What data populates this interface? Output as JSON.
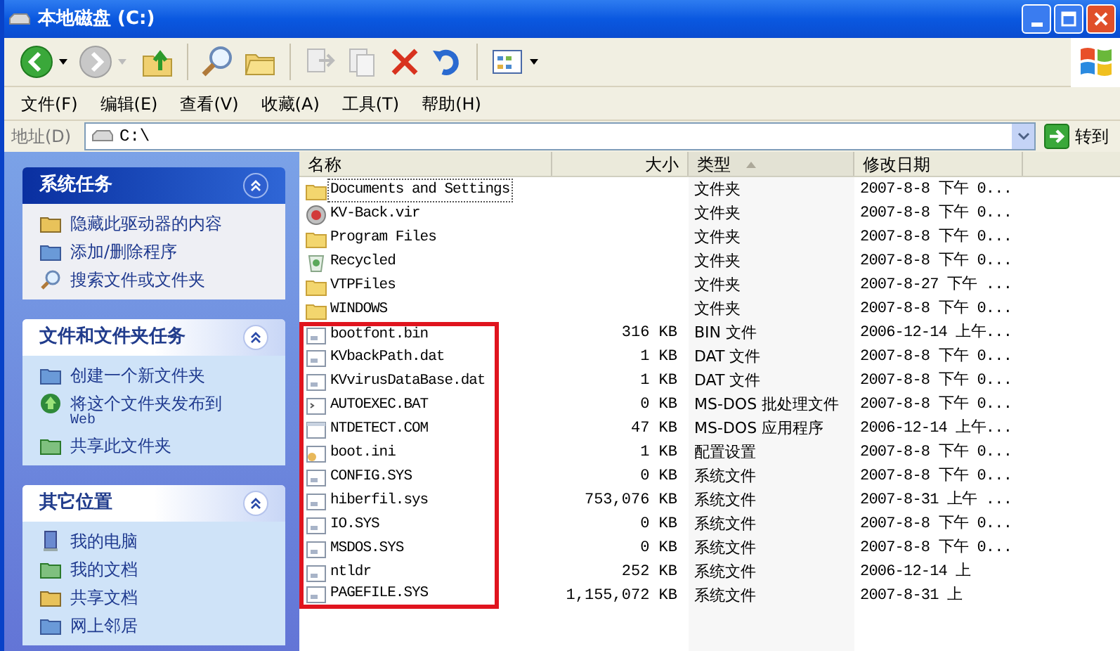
{
  "window": {
    "title": "本地磁盘 (C:)"
  },
  "menu": [
    "文件(F)",
    "编辑(E)",
    "查看(V)",
    "收藏(A)",
    "工具(T)",
    "帮助(H)"
  ],
  "address": {
    "label": "地址(D)",
    "value": "C:\\",
    "go": "转到"
  },
  "task_panels": [
    {
      "title": "系统任务",
      "emphasized": true,
      "items": [
        "隐藏此驱动器的内容",
        "添加/删除程序",
        "搜索文件或文件夹"
      ]
    },
    {
      "title": "文件和文件夹任务",
      "emphasized": false,
      "items": [
        "创建一个新文件夹",
        "将这个文件夹发布到",
        "共享此文件夹"
      ],
      "web_note": "Web"
    },
    {
      "title": "其它位置",
      "emphasized": false,
      "items": [
        "我的电脑",
        "我的文档",
        "共享文档",
        "网上邻居"
      ]
    }
  ],
  "columns": [
    {
      "label": "名称",
      "sorted": false
    },
    {
      "label": "大小",
      "sorted": false
    },
    {
      "label": "类型",
      "sorted": true
    },
    {
      "label": "修改日期",
      "sorted": false
    }
  ],
  "rows": [
    {
      "kind": "folder",
      "name": "Documents and Settings",
      "size": "",
      "type": "文件夹",
      "date": "2007-8-8 下午 0...",
      "focused": true,
      "marked": false
    },
    {
      "kind": "shield",
      "name": "KV-Back.vir",
      "size": "",
      "type": "文件夹",
      "date": "2007-8-8 下午 0...",
      "focused": false,
      "marked": false
    },
    {
      "kind": "folder",
      "name": "Program Files",
      "size": "",
      "type": "文件夹",
      "date": "2007-8-8 下午 0...",
      "focused": false,
      "marked": false
    },
    {
      "kind": "recycle",
      "name": "Recycled",
      "size": "",
      "type": "文件夹",
      "date": "2007-8-8 下午 0...",
      "focused": false,
      "marked": false
    },
    {
      "kind": "folder",
      "name": "VTPFiles",
      "size": "",
      "type": "文件夹",
      "date": "2007-8-27 下午 ...",
      "focused": false,
      "marked": false
    },
    {
      "kind": "folder",
      "name": "WINDOWS",
      "size": "",
      "type": "文件夹",
      "date": "2007-8-8 下午 0...",
      "focused": false,
      "marked": false
    },
    {
      "kind": "file",
      "name": "bootfont.bin",
      "size": "316 KB",
      "type": "BIN 文件",
      "date": "2006-12-14 上午...",
      "focused": false,
      "marked": true
    },
    {
      "kind": "file",
      "name": "KVbackPath.dat",
      "size": "1 KB",
      "type": "DAT 文件",
      "date": "2007-8-8 下午 0...",
      "focused": false,
      "marked": true
    },
    {
      "kind": "file",
      "name": "KVvirusDataBase.dat",
      "size": "1 KB",
      "type": "DAT 文件",
      "date": "2007-8-8 下午 0...",
      "focused": false,
      "marked": true
    },
    {
      "kind": "batch",
      "name": "AUTOEXEC.BAT",
      "size": "0 KB",
      "type": "MS-DOS 批处理文件",
      "date": "2007-8-8 下午 0...",
      "focused": false,
      "marked": true
    },
    {
      "kind": "program",
      "name": "NTDETECT.COM",
      "size": "47 KB",
      "type": "MS-DOS 应用程序",
      "date": "2006-12-14 上午...",
      "focused": false,
      "marked": true
    },
    {
      "kind": "settings",
      "name": "boot.ini",
      "size": "1 KB",
      "type": "配置设置",
      "date": "2007-8-8 下午 0...",
      "focused": false,
      "marked": true
    },
    {
      "kind": "file",
      "name": "CONFIG.SYS",
      "size": "0 KB",
      "type": "系统文件",
      "date": "2007-8-8 下午 0...",
      "focused": false,
      "marked": true
    },
    {
      "kind": "file",
      "name": "hiberfil.sys",
      "size": "753,076 KB",
      "type": "系统文件",
      "date": "2007-8-31 上午 ...",
      "focused": false,
      "marked": true
    },
    {
      "kind": "file",
      "name": "IO.SYS",
      "size": "0 KB",
      "type": "系统文件",
      "date": "2007-8-8 下午 0...",
      "focused": false,
      "marked": true
    },
    {
      "kind": "file",
      "name": "MSDOS.SYS",
      "size": "0 KB",
      "type": "系统文件",
      "date": "2007-8-8 下午 0...",
      "focused": false,
      "marked": true
    },
    {
      "kind": "file",
      "name": "ntldr",
      "size": "252 KB",
      "type": "系统文件",
      "date": "2006-12-14 上",
      "focused": false,
      "marked": true
    },
    {
      "kind": "file",
      "name": "PAGEFILE.SYS",
      "size": "1,155,072 KB",
      "type": "系统文件",
      "date": "2007-8-31 上",
      "focused": false,
      "marked": true
    }
  ]
}
